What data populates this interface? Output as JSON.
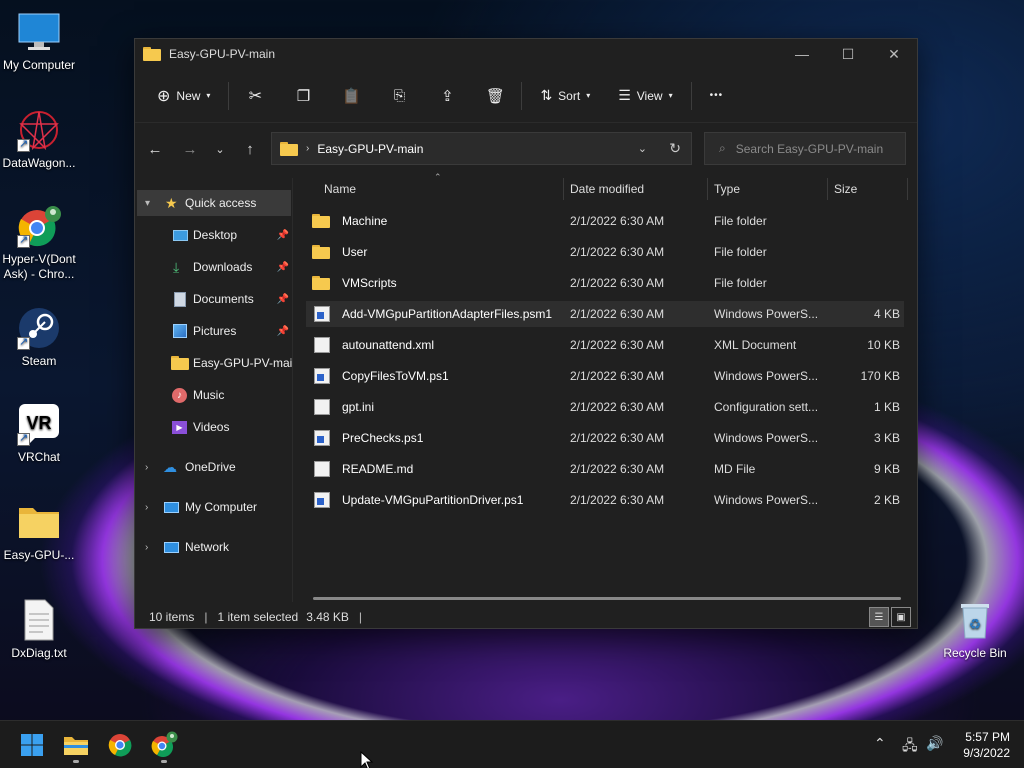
{
  "desktop": {
    "icons": [
      {
        "label": "My Computer"
      },
      {
        "label": "DataWagon..."
      },
      {
        "label": "Hyper-V(Dont Ask) - Chro..."
      },
      {
        "label": "Steam"
      },
      {
        "label": "VRChat"
      },
      {
        "label": "Easy-GPU-..."
      },
      {
        "label": "DxDiag.txt"
      },
      {
        "label": "Recycle Bin"
      }
    ]
  },
  "window": {
    "title": "Easy-GPU-PV-main",
    "controls": {
      "minimize": "—",
      "maximize": "☐",
      "close": "✕"
    }
  },
  "toolbar": {
    "new_label": "New",
    "sort_label": "Sort",
    "view_label": "View",
    "more_label": "•••"
  },
  "address": {
    "crumb": "Easy-GPU-PV-main",
    "search_placeholder": "Search Easy-GPU-PV-main"
  },
  "sidebar": {
    "quick_access": "Quick access",
    "items": [
      {
        "label": "Desktop"
      },
      {
        "label": "Downloads"
      },
      {
        "label": "Documents"
      },
      {
        "label": "Pictures"
      },
      {
        "label": "Easy-GPU-PV-main"
      },
      {
        "label": "Music"
      },
      {
        "label": "Videos"
      }
    ],
    "onedrive": "OneDrive",
    "mycomputer": "My Computer",
    "network": "Network"
  },
  "columns": {
    "name": "Name",
    "date": "Date modified",
    "type": "Type",
    "size": "Size"
  },
  "files": [
    {
      "name": "Machine",
      "date": "2/1/2022 6:30 AM",
      "type": "File folder",
      "size": "",
      "icon": "folder"
    },
    {
      "name": "User",
      "date": "2/1/2022 6:30 AM",
      "type": "File folder",
      "size": "",
      "icon": "folder"
    },
    {
      "name": "VMScripts",
      "date": "2/1/2022 6:30 AM",
      "type": "File folder",
      "size": "",
      "icon": "folder"
    },
    {
      "name": "Add-VMGpuPartitionAdapterFiles.psm1",
      "date": "2/1/2022 6:30 AM",
      "type": "Windows PowerS...",
      "size": "4 KB",
      "icon": "powershell"
    },
    {
      "name": "autounattend.xml",
      "date": "2/1/2022 6:30 AM",
      "type": "XML Document",
      "size": "10 KB",
      "icon": "xml"
    },
    {
      "name": "CopyFilesToVM.ps1",
      "date": "2/1/2022 6:30 AM",
      "type": "Windows PowerS...",
      "size": "170 KB",
      "icon": "powershell"
    },
    {
      "name": "gpt.ini",
      "date": "2/1/2022 6:30 AM",
      "type": "Configuration sett...",
      "size": "1 KB",
      "icon": "config"
    },
    {
      "name": "PreChecks.ps1",
      "date": "2/1/2022 6:30 AM",
      "type": "Windows PowerS...",
      "size": "3 KB",
      "icon": "powershell"
    },
    {
      "name": "README.md",
      "date": "2/1/2022 6:30 AM",
      "type": "MD File",
      "size": "9 KB",
      "icon": "file"
    },
    {
      "name": "Update-VMGpuPartitionDriver.ps1",
      "date": "2/1/2022 6:30 AM",
      "type": "Windows PowerS...",
      "size": "2 KB",
      "icon": "powershell"
    }
  ],
  "status": {
    "count": "10 items",
    "selected": "1 item selected",
    "size": "3.48 KB"
  },
  "taskbar": {
    "time": "5:57 PM",
    "date": "9/3/2022"
  },
  "colors": {
    "accent": "#f6c94e",
    "window_bg": "#202020",
    "selection": "#2e2e2e"
  }
}
